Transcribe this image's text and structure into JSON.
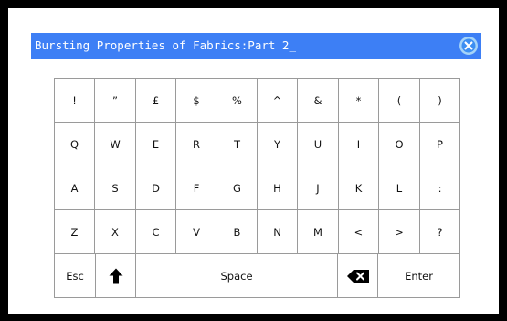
{
  "input": {
    "value": "Bursting Properties of Fabrics:Part 2_",
    "clear_icon": "close-circle-icon",
    "accent": "#3d7ff5"
  },
  "keyboard": {
    "rows": [
      [
        "!",
        "”",
        "£",
        "$",
        "%",
        "^",
        "&",
        "*",
        "(",
        ")"
      ],
      [
        "Q",
        "W",
        "E",
        "R",
        "T",
        "Y",
        "U",
        "I",
        "O",
        "P"
      ],
      [
        "A",
        "S",
        "D",
        "F",
        "G",
        "H",
        "J",
        "K",
        "L",
        ":"
      ],
      [
        "Z",
        "X",
        "C",
        "V",
        "B",
        "N",
        "M",
        "<",
        ">",
        "?"
      ]
    ],
    "bottom": {
      "esc": "Esc",
      "shift_icon": "shift-arrow-up-icon",
      "space": "Space",
      "backspace_icon": "backspace-icon",
      "enter": "Enter"
    }
  }
}
